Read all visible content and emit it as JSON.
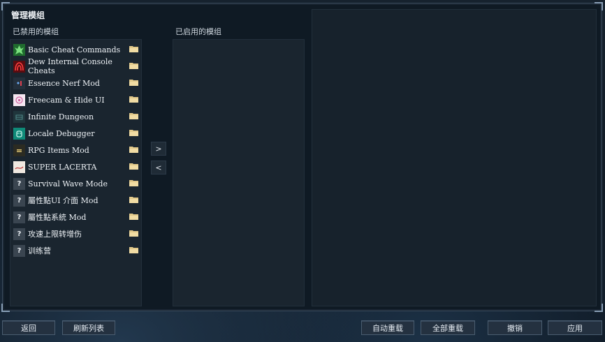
{
  "dialog": {
    "title": "管理模组",
    "disabled_label": "已禁用的模组",
    "enabled_label": "已启用的模组"
  },
  "disabled_mods": [
    {
      "name": "Basic Cheat Commands",
      "icon": "cheat-icon",
      "color": "#3fa34d"
    },
    {
      "name": "Dew Internal Console Cheats",
      "icon": "console-icon",
      "color": "#c0232a"
    },
    {
      "name": "Essence Nerf Mod",
      "icon": "essence-icon",
      "color": "#5a8fd0"
    },
    {
      "name": "Freecam & Hide UI",
      "icon": "freecam-icon",
      "color": "#d86aa0"
    },
    {
      "name": "Infinite Dungeon",
      "icon": "dungeon-icon",
      "color": "#2e4a52"
    },
    {
      "name": "Locale Debugger",
      "icon": "locale-icon",
      "color": "#1aa08a"
    },
    {
      "name": "RPG Items Mod",
      "icon": "rpg-icon",
      "color": "#3a3a2a"
    },
    {
      "name": "SUPER LACERTA",
      "icon": "lacerta-icon",
      "color": "#e8dcd0"
    },
    {
      "name": "Survival Wave Mode",
      "icon": "?",
      "color": "#3a4550"
    },
    {
      "name": "屬性點UI 介面 Mod",
      "icon": "?",
      "color": "#3a4550"
    },
    {
      "name": "屬性點系統 Mod",
      "icon": "?",
      "color": "#3a4550"
    },
    {
      "name": "攻速上限转增伤",
      "icon": "?",
      "color": "#3a4550"
    },
    {
      "name": "训练营",
      "icon": "?",
      "color": "#3a4550"
    }
  ],
  "enabled_mods": [],
  "transfer": {
    "enable_arrow": ">",
    "disable_arrow": "<"
  },
  "buttons": {
    "back": "返回",
    "refresh": "刷新列表",
    "auto_reload": "自动重载",
    "reload_all": "全部重载",
    "cancel": "撤销",
    "apply": "应用"
  }
}
